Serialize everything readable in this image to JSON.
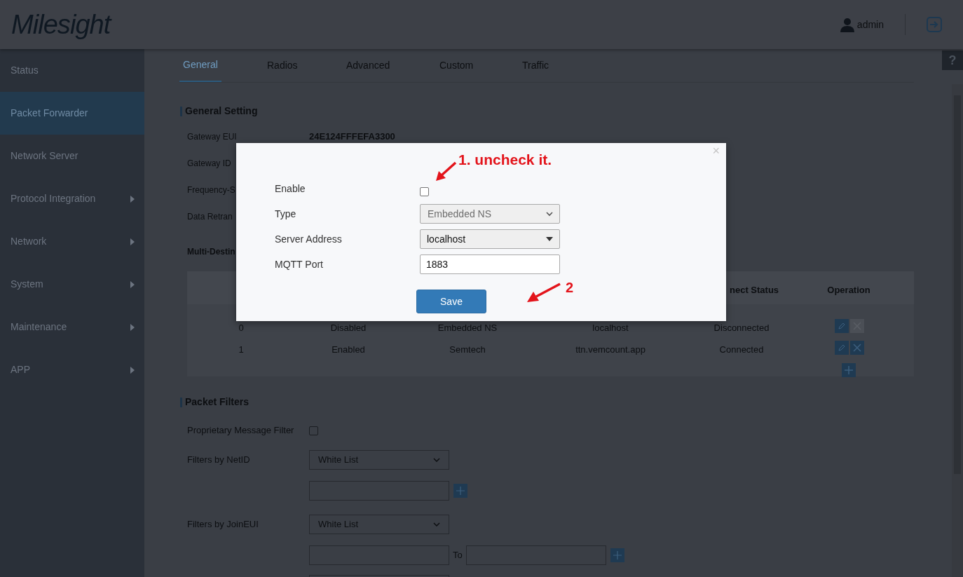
{
  "header": {
    "logo": "Milesight",
    "user": "admin"
  },
  "help": "?",
  "sidebar": {
    "items": [
      {
        "label": "Status",
        "selected": false,
        "submenu": false
      },
      {
        "label": "Packet Forwarder",
        "selected": true,
        "submenu": false
      },
      {
        "label": "Network Server",
        "selected": false,
        "submenu": false
      },
      {
        "label": "Protocol Integration",
        "selected": false,
        "submenu": true
      },
      {
        "label": "Network",
        "selected": false,
        "submenu": true
      },
      {
        "label": "System",
        "selected": false,
        "submenu": true
      },
      {
        "label": "Maintenance",
        "selected": false,
        "submenu": true
      },
      {
        "label": "APP",
        "selected": false,
        "submenu": true
      }
    ]
  },
  "tabs": [
    {
      "label": "General",
      "selected": true
    },
    {
      "label": "Radios",
      "selected": false
    },
    {
      "label": "Advanced",
      "selected": false
    },
    {
      "label": "Custom",
      "selected": false
    },
    {
      "label": "Traffic",
      "selected": false
    }
  ],
  "general_setting": {
    "title": "General Setting",
    "fields": [
      {
        "label": "Gateway EUI",
        "value": "24E124FFFEFA3300"
      },
      {
        "label": "Gateway ID"
      },
      {
        "label": "Frequency-S"
      },
      {
        "label": "Data Retran"
      }
    ]
  },
  "multi_destination": {
    "title": "Multi-Destin",
    "columns": [
      "",
      "",
      "",
      "",
      "nect Status",
      "Operation"
    ],
    "rows": [
      {
        "cells": [
          "0",
          "Disabled",
          "Embedded NS",
          "localhost",
          "Disconnected"
        ],
        "deletable": false
      },
      {
        "cells": [
          "1",
          "Enabled",
          "Semtech",
          "ttn.vemcount.app",
          "Connected"
        ],
        "deletable": true
      }
    ]
  },
  "packet_filters": {
    "title": "Packet Filters",
    "proprietary": {
      "label": "Proprietary Message Filter",
      "checked": false
    },
    "netid": {
      "label": "Filters by NetID",
      "value": "White List"
    },
    "joineui": {
      "label": "Filters by JoinEUI",
      "value": "White List",
      "range_word": "To"
    }
  },
  "modal": {
    "close": "×",
    "fields": [
      {
        "kind": "checkbox",
        "label": "Enable",
        "checked": false
      },
      {
        "kind": "select",
        "label": "Type",
        "value": "Embedded NS",
        "disabled": true
      },
      {
        "kind": "combo",
        "label": "Server Address",
        "value": "localhost"
      },
      {
        "kind": "input",
        "label": "MQTT Port",
        "value": "1883"
      }
    ],
    "save": "Save"
  },
  "annotations": [
    {
      "text": "1. uncheck it."
    },
    {
      "text": "2"
    }
  ]
}
